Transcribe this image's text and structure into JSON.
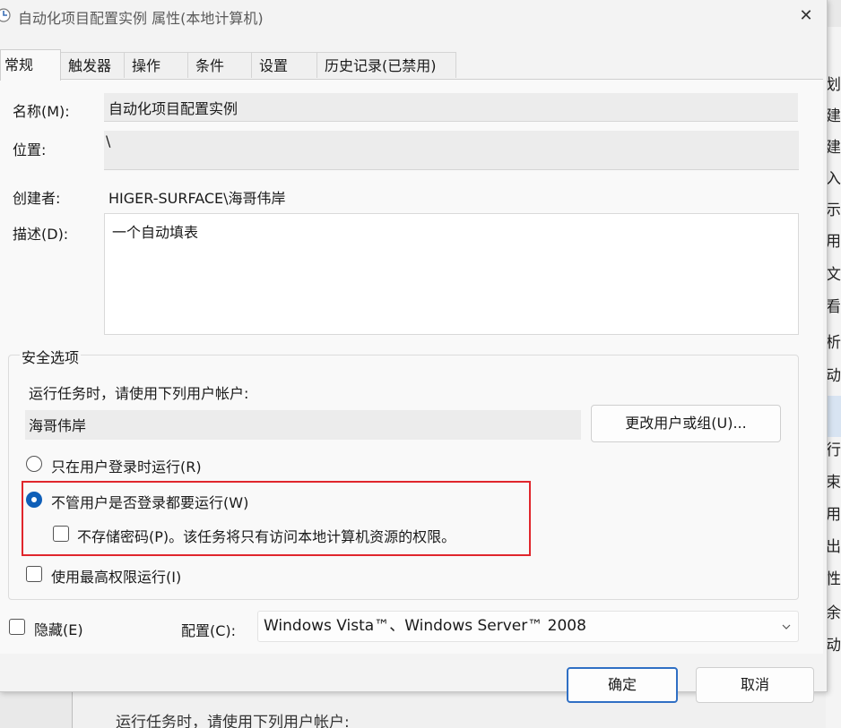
{
  "window": {
    "title": "自动化项目配置实例 属性(本地计算机)",
    "close_glyph": "✕"
  },
  "tabs": [
    {
      "label": "常规",
      "active": true
    },
    {
      "label": "触发器",
      "active": false
    },
    {
      "label": "操作",
      "active": false
    },
    {
      "label": "条件",
      "active": false
    },
    {
      "label": "设置",
      "active": false
    },
    {
      "label": "历史记录(已禁用)",
      "active": false
    }
  ],
  "general": {
    "name_label": "名称(M):",
    "name_value": "自动化项目配置实例",
    "location_label": "位置:",
    "location_value": "\\",
    "author_label": "创建者:",
    "author_value": "HIGER-SURFACE\\海哥伟岸",
    "description_label": "描述(D):",
    "description_value": "一个自动填表"
  },
  "security": {
    "legend": "安全选项",
    "run_as_prompt": "运行任务时，请使用下列用户帐户:",
    "user_account": "海哥伟岸",
    "change_user_button": "更改用户或组(U)...",
    "option_logged_on": "只在用户登录时运行(R)",
    "option_whether_logged_on": "不管用户是否登录都要运行(W)",
    "option_do_not_store_password": "不存储密码(P)。该任务将只有访问本地计算机资源的权限。",
    "option_highest_privileges": "使用最高权限运行(I)",
    "selected_option": "option_whether_logged_on"
  },
  "bottom": {
    "hidden_label": "隐藏(E)",
    "configure_label": "配置(C):",
    "configure_value": "Windows Vista™、Windows Server™ 2008"
  },
  "footer": {
    "ok_button": "确定",
    "cancel_button": "取消"
  },
  "background_window": {
    "side_chars": [
      "划",
      "建",
      "建",
      "入",
      "示",
      "用",
      "文",
      "看",
      "析",
      "动",
      "行",
      "束",
      "用",
      "出",
      "性",
      "余",
      "动"
    ],
    "bottom_text": "运行任务时，请使用下列用户帐户:"
  },
  "colors": {
    "accent": "#0f5fb8",
    "primary_button_border": "#2f6fc4",
    "highlight_box": "#e0262c"
  }
}
